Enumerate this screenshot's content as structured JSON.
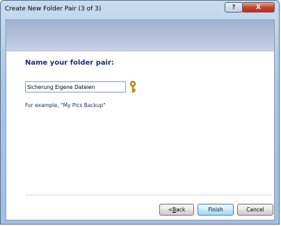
{
  "window": {
    "title": "Create New Folder Pair (3 of 3)",
    "help_glyph": "?",
    "close_glyph": "X"
  },
  "page": {
    "heading": "Name your folder pair:",
    "name_value": "Sicherung Eigene Dateien",
    "example_text": "For example, \"My Pics Backup\"",
    "key_icon": "key-icon"
  },
  "buttons": {
    "back_prefix": "< ",
    "back_hotkey": "B",
    "back_rest": "ack",
    "finish": "Finish",
    "cancel": "Cancel"
  },
  "colors": {
    "heading": "#1b2f6b",
    "banner": "#a3b1d0",
    "key": "#d4a000"
  }
}
